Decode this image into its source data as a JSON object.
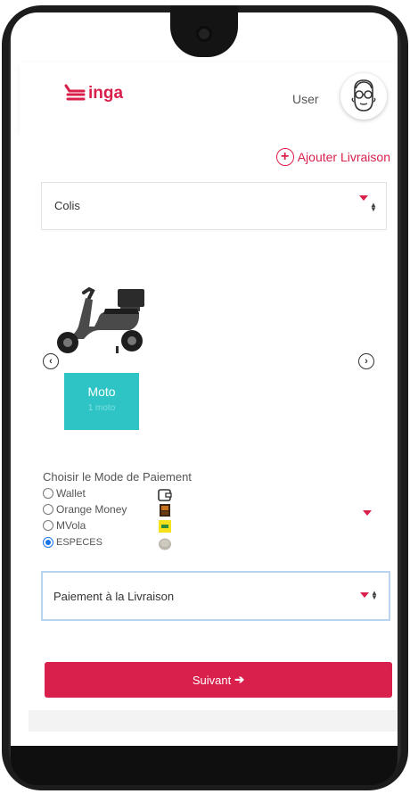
{
  "header": {
    "brand_name": "inga",
    "user_label": "User"
  },
  "add_delivery": {
    "label": "Ajouter Livraison"
  },
  "package_select": {
    "selected": "Colis"
  },
  "vehicles": [
    {
      "name": "Moto",
      "subtitle": "1 moto"
    }
  ],
  "payment": {
    "title": "Choisir le Mode de Paiement",
    "options": [
      {
        "label": "Wallet",
        "icon": "wallet-icon",
        "checked": false
      },
      {
        "label": "Orange Money",
        "icon": "orange-money-icon",
        "checked": false
      },
      {
        "label": "MVola",
        "icon": "mvola-icon",
        "checked": false
      },
      {
        "label": "ESPECES",
        "icon": "coin-icon",
        "checked": true
      }
    ],
    "method_selected": "Paiement à la Livraison"
  },
  "actions": {
    "next_label": "Suivant"
  },
  "colors": {
    "accent": "#d91f4b",
    "vehicle_card": "#2ec4c6",
    "radio_selected": "#1a73e8"
  }
}
